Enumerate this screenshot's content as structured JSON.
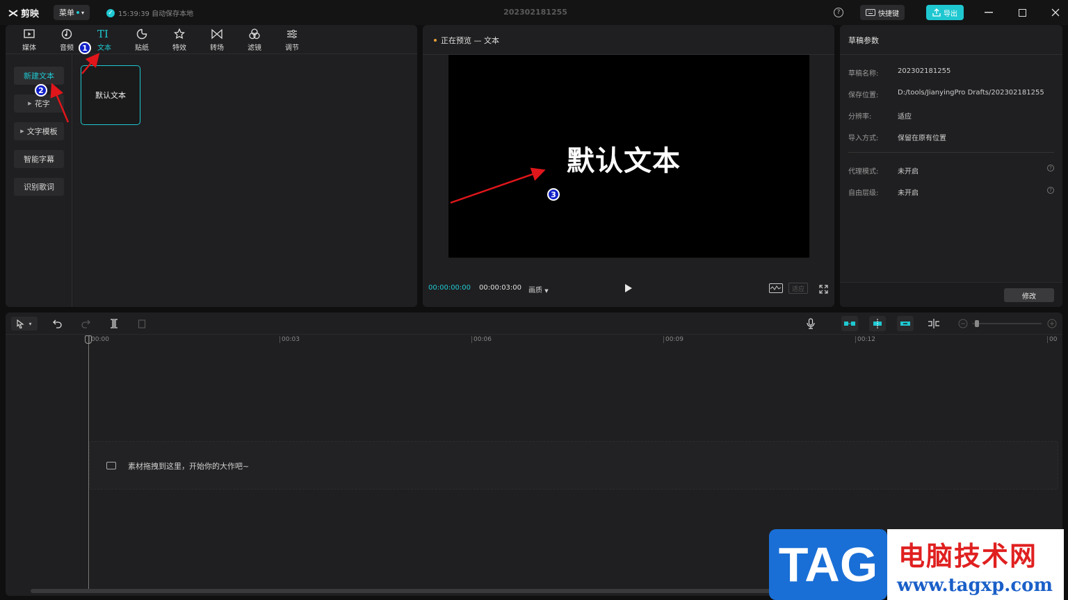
{
  "titlebar": {
    "app_name": "剪映",
    "menu_label": "菜单",
    "save_status": "15:39:39 自动保存本地",
    "project_title": "202302181255",
    "shortcut_label": "快捷键",
    "export_label": "导出"
  },
  "tabs": [
    {
      "label": "媒体",
      "icon": "media-icon"
    },
    {
      "label": "音频",
      "icon": "audio-icon"
    },
    {
      "label": "文本",
      "icon": "text-icon",
      "active": true
    },
    {
      "label": "贴纸",
      "icon": "sticker-icon"
    },
    {
      "label": "特效",
      "icon": "effects-icon"
    },
    {
      "label": "转场",
      "icon": "transition-icon"
    },
    {
      "label": "滤镜",
      "icon": "filter-icon"
    },
    {
      "label": "调节",
      "icon": "adjust-icon"
    }
  ],
  "left_nav": [
    {
      "label": "新建文本",
      "active": true
    },
    {
      "label": "花字",
      "expandable": true
    },
    {
      "label": "文字模板",
      "expandable": true
    },
    {
      "label": "智能字幕"
    },
    {
      "label": "识别歌词"
    }
  ],
  "text_card": {
    "label": "默认文本"
  },
  "preview": {
    "title": "正在预览 — 文本",
    "canvas_text": "默认文本",
    "time_current": "00:00:00:00",
    "time_total": "00:00:03:00",
    "quality_label": "画质",
    "fit_label": "适应"
  },
  "draft_params": {
    "title": "草稿参数",
    "rows": [
      {
        "key": "草稿名称:",
        "value": "202302181255"
      },
      {
        "key": "保存位置:",
        "value": "D:/tools/JianyingPro Drafts/202302181255"
      },
      {
        "key": "分辨率:",
        "value": "适应"
      },
      {
        "key": "导入方式:",
        "value": "保留在原有位置"
      }
    ],
    "rows2": [
      {
        "key": "代理模式:",
        "value": "未开启"
      },
      {
        "key": "自由层级:",
        "value": "未开启"
      }
    ],
    "modify_label": "修改"
  },
  "timeline": {
    "ticks": [
      "00:00",
      "00:03",
      "00:06",
      "00:09",
      "00:12",
      "00"
    ],
    "drop_hint": "素材拖拽到这里，开始你的大作吧~"
  },
  "annotations": [
    "1",
    "2",
    "3"
  ],
  "watermark": {
    "tag": "TAG",
    "title": "电脑技术网",
    "url": "www.tagxp.com"
  },
  "colors": {
    "accent": "#1fc8d1",
    "annotation": "#e0161b"
  }
}
